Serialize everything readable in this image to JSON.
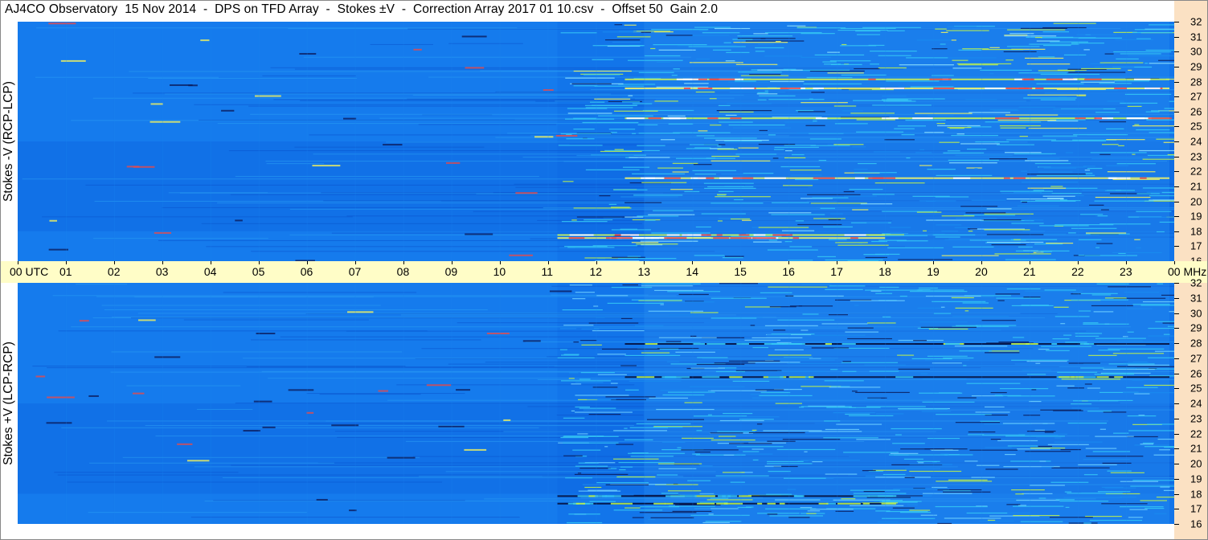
{
  "title": "AJ4CO Observatory  15 Nov 2014  -  DPS on TFD Array  -  Stokes ±V  -  Correction Array 2017 01 10.csv  -  Offset 50  Gain 2.0",
  "chart_data": {
    "type": "heatmap",
    "x_axis": {
      "quantity": "time",
      "unit": "UTC",
      "range": [
        "00",
        "00"
      ],
      "ticks": [
        "00",
        "01",
        "02",
        "03",
        "04",
        "05",
        "06",
        "07",
        "08",
        "09",
        "10",
        "11",
        "12",
        "13",
        "14",
        "15",
        "16",
        "17",
        "18",
        "19",
        "20",
        "21",
        "22",
        "23",
        "00"
      ],
      "start_label": "00",
      "start_unit": "UTC",
      "end_label": "00",
      "end_unit": "MHz"
    },
    "y_axis": {
      "unit": "MHz",
      "range": [
        16,
        32
      ],
      "ticks": [
        "32",
        "31",
        "30",
        "29",
        "28",
        "27",
        "26",
        "25",
        "24",
        "23",
        "22",
        "21",
        "20",
        "19",
        "18",
        "17",
        "16"
      ]
    },
    "panels": [
      {
        "ylabel": "Stokes -V (RCP-LCP)",
        "event_bands_mhz": [
          17.6,
          17.8,
          21.6,
          25.6,
          27.6,
          28.2
        ],
        "event_start_hour": 11.2,
        "event_strong_start_hour": 13.0,
        "colors": [
          "#0a63e6",
          "#1a8bf0",
          "#35c8f5",
          "#bff24a",
          "#f5f45c",
          "#e84a4a",
          "#0b1d5e"
        ]
      },
      {
        "ylabel": "Stokes +V (LCP-RCP)",
        "event_bands_mhz": [
          17.4,
          17.9,
          25.8,
          28.0
        ],
        "event_start_hour": 11.2,
        "event_strong_start_hour": 13.0,
        "colors": [
          "#0a63e6",
          "#1a8bf0",
          "#35c8f5",
          "#bff24a",
          "#f5f45c",
          "#0b1d5e"
        ]
      }
    ],
    "colors": {
      "background_field": "#1275ea",
      "time_axis_bg": "#fffdc7",
      "freq_axis_bg": "#fbe1c3"
    }
  }
}
